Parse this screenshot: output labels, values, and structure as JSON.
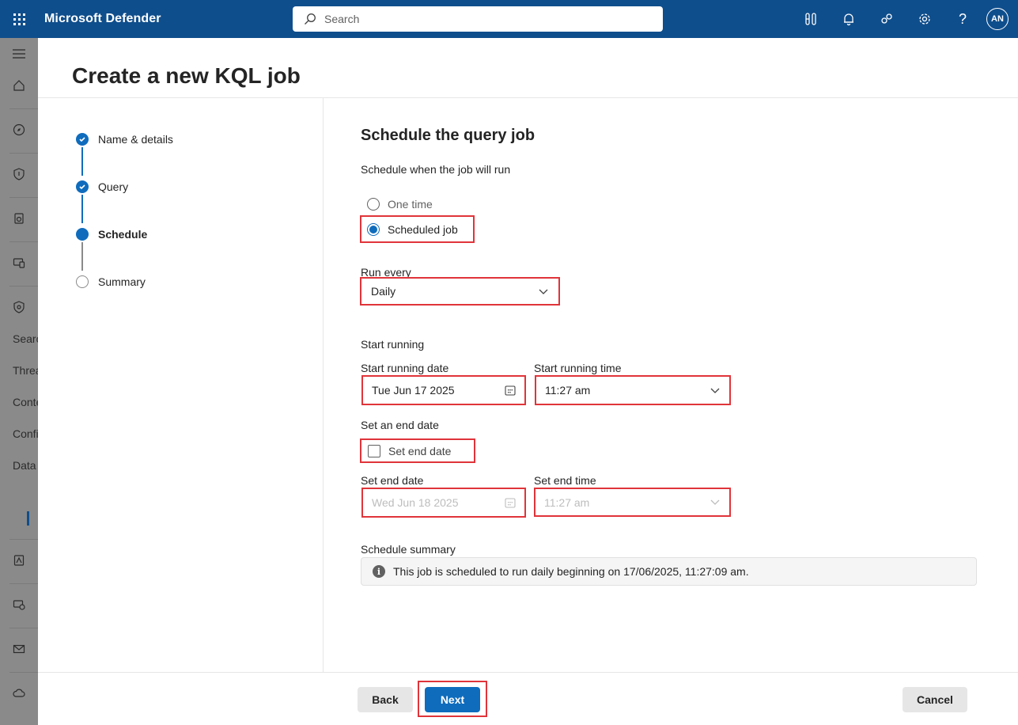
{
  "app": {
    "name": "Microsoft Defender",
    "search_placeholder": "Search",
    "avatar_initials": "AN"
  },
  "leftnav": {
    "labels": [
      "Searc",
      "Threa",
      "Conte",
      "Confi",
      "Data"
    ]
  },
  "page": {
    "title": "Create a new KQL job"
  },
  "steps": [
    {
      "label": "Name & details",
      "state": "done"
    },
    {
      "label": "Query",
      "state": "done"
    },
    {
      "label": "Schedule",
      "state": "current"
    },
    {
      "label": "Summary",
      "state": "todo"
    }
  ],
  "form": {
    "title": "Schedule the query job",
    "schedule_prompt": "Schedule when the job will run",
    "option_one_time": "One time",
    "option_scheduled": "Scheduled job",
    "selected_option": "Scheduled job",
    "run_every_label": "Run every",
    "run_every_value": "Daily",
    "start_running_heading": "Start running",
    "start_date_label": "Start running date",
    "start_date_value": "Tue Jun 17 2025",
    "start_time_label": "Start running time",
    "start_time_value": "11:27 am",
    "end_date_heading": "Set an end date",
    "set_end_date_checkbox": "Set end date",
    "set_end_date_checked": false,
    "end_date_label": "Set end date",
    "end_date_value": "Wed Jun 18 2025",
    "end_time_label": "Set end time",
    "end_time_value": "11:27 am",
    "summary_label": "Schedule summary",
    "summary_text": "This job is scheduled to run daily beginning on 17/06/2025, 11:27:09 am."
  },
  "footer": {
    "back": "Back",
    "next": "Next",
    "cancel": "Cancel"
  },
  "colors": {
    "topbar": "#0f4e8c",
    "accent": "#0f6cbd",
    "highlight": "#e0343a"
  }
}
